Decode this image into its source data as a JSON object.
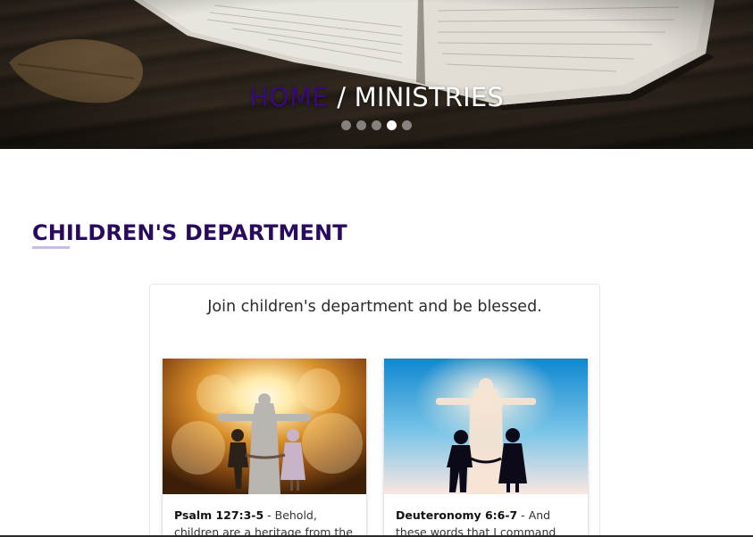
{
  "hero": {
    "home_link": "HOME",
    "separator": " / ",
    "current": "MINISTRIES",
    "slides": 5,
    "active_slide": 4
  },
  "section": {
    "title": "CHILDREN'S DEPARTMENT"
  },
  "panel": {
    "heading": "Join children's department and be blessed.",
    "cards": [
      {
        "reference": "Psalm 127:3-5",
        "text": " - Behold, children are a heritage from the LORD, the"
      },
      {
        "reference": "Deuteronomy 6:6-7",
        "text": " - And these words that I command you today"
      }
    ]
  },
  "colors": {
    "home_link": "#3a0a78",
    "section_title": "#2a0a5e",
    "underline": "#c9b8e8"
  }
}
